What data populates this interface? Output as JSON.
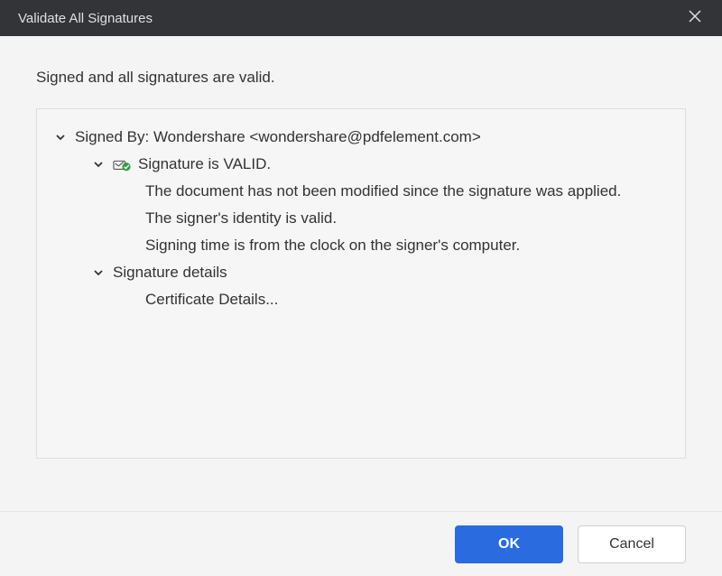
{
  "titlebar": {
    "title": "Validate All Signatures"
  },
  "status_message": "Signed and all signatures are valid.",
  "tree": {
    "signed_by_label": "Signed By: Wondershare <wondershare@pdfelement.com>",
    "valid_label": "Signature is VALID.",
    "detail_not_modified": "The document has not been modified since the signature was applied.",
    "detail_identity_valid": "The signer's identity is valid.",
    "detail_signing_time": "Signing time is from the clock on the signer's computer.",
    "sig_details_label": "Signature details",
    "cert_details_label": "Certificate Details..."
  },
  "footer": {
    "ok_label": "OK",
    "cancel_label": "Cancel"
  }
}
